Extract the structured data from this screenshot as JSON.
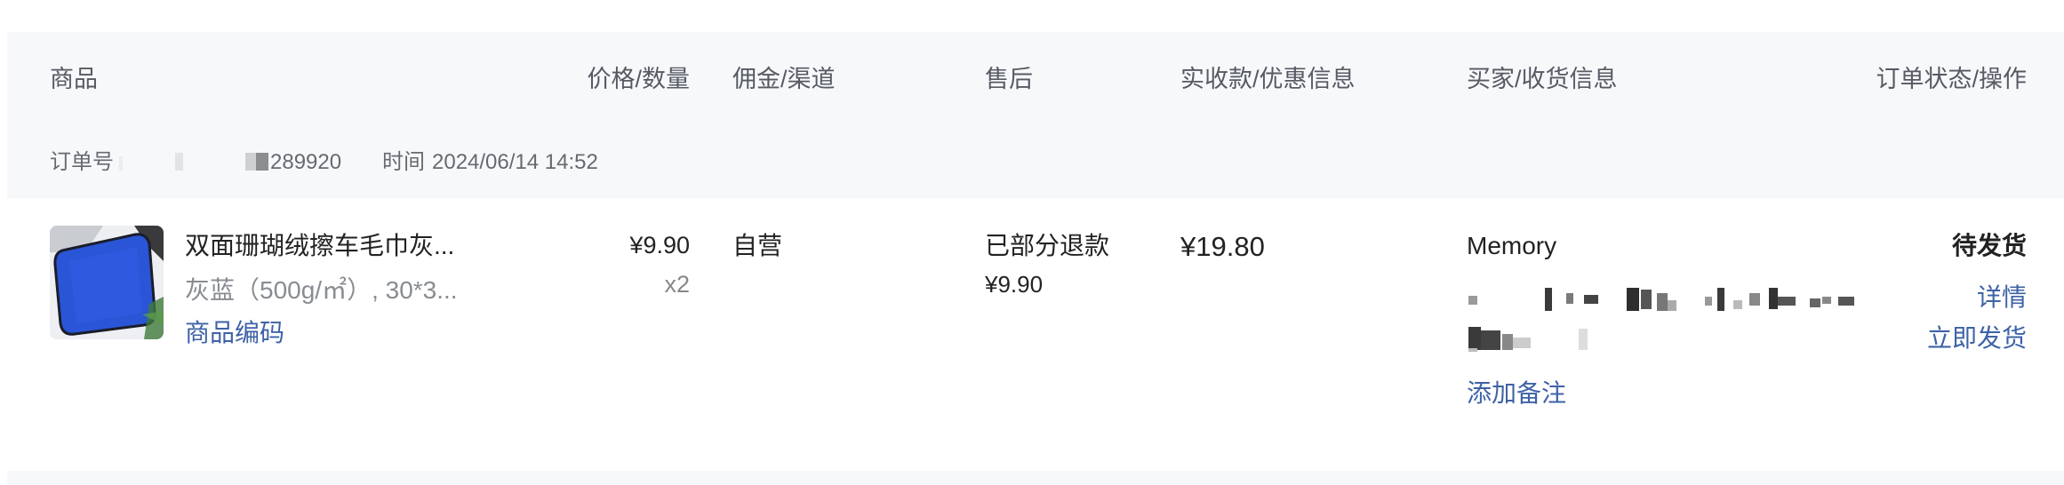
{
  "table_header": {
    "product": "商品",
    "price_qty": "价格/数量",
    "commission_channel": "佣金/渠道",
    "after_sale": "售后",
    "received_discount": "实收款/优惠信息",
    "buyer_shipping": "买家/收货信息",
    "status_action": "订单状态/操作"
  },
  "order": {
    "order_no_label": "订单号",
    "order_no_visible_suffix": "289920",
    "time_label": "时间",
    "time_value": "2024/06/14 14:52"
  },
  "item": {
    "title": "双面珊瑚绒擦车毛巾灰...",
    "spec": "灰蓝（500g/㎡）, 30*3...",
    "product_code_link": "商品编码",
    "price": "¥9.90",
    "quantity": "x2",
    "channel": "自营",
    "after_sale_status": "已部分退款",
    "refund_amount": "¥9.90",
    "received_amount": "¥19.80",
    "buyer_name": "Memory",
    "add_note_link": "添加备注",
    "order_status": "待发货",
    "detail_link": "详情",
    "ship_now_link": "立即发货"
  },
  "icons": {
    "product_image": "blue-towel-thumbnail"
  },
  "colors": {
    "link": "#3d62a6",
    "header_bg": "#f7f8fa",
    "towel_blue": "#2a55d6"
  }
}
